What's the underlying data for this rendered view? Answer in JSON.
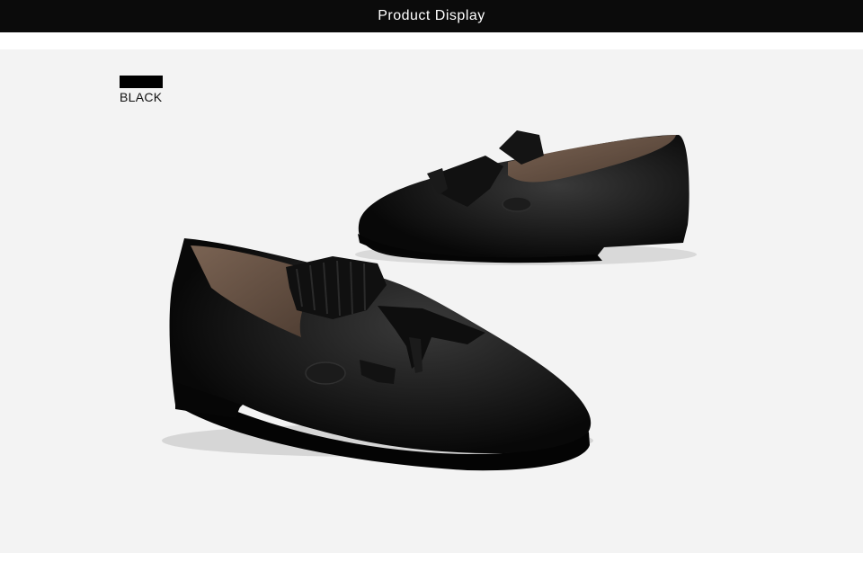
{
  "header": {
    "title": "Product Display"
  },
  "color_swatch": {
    "label": "BLACK",
    "color": "#000000"
  },
  "product_image": {
    "subject": "shoe-icon",
    "colors": {
      "leather": "#0d0d0d",
      "lining": "#6b5647",
      "background": "#f3f3f3"
    }
  }
}
